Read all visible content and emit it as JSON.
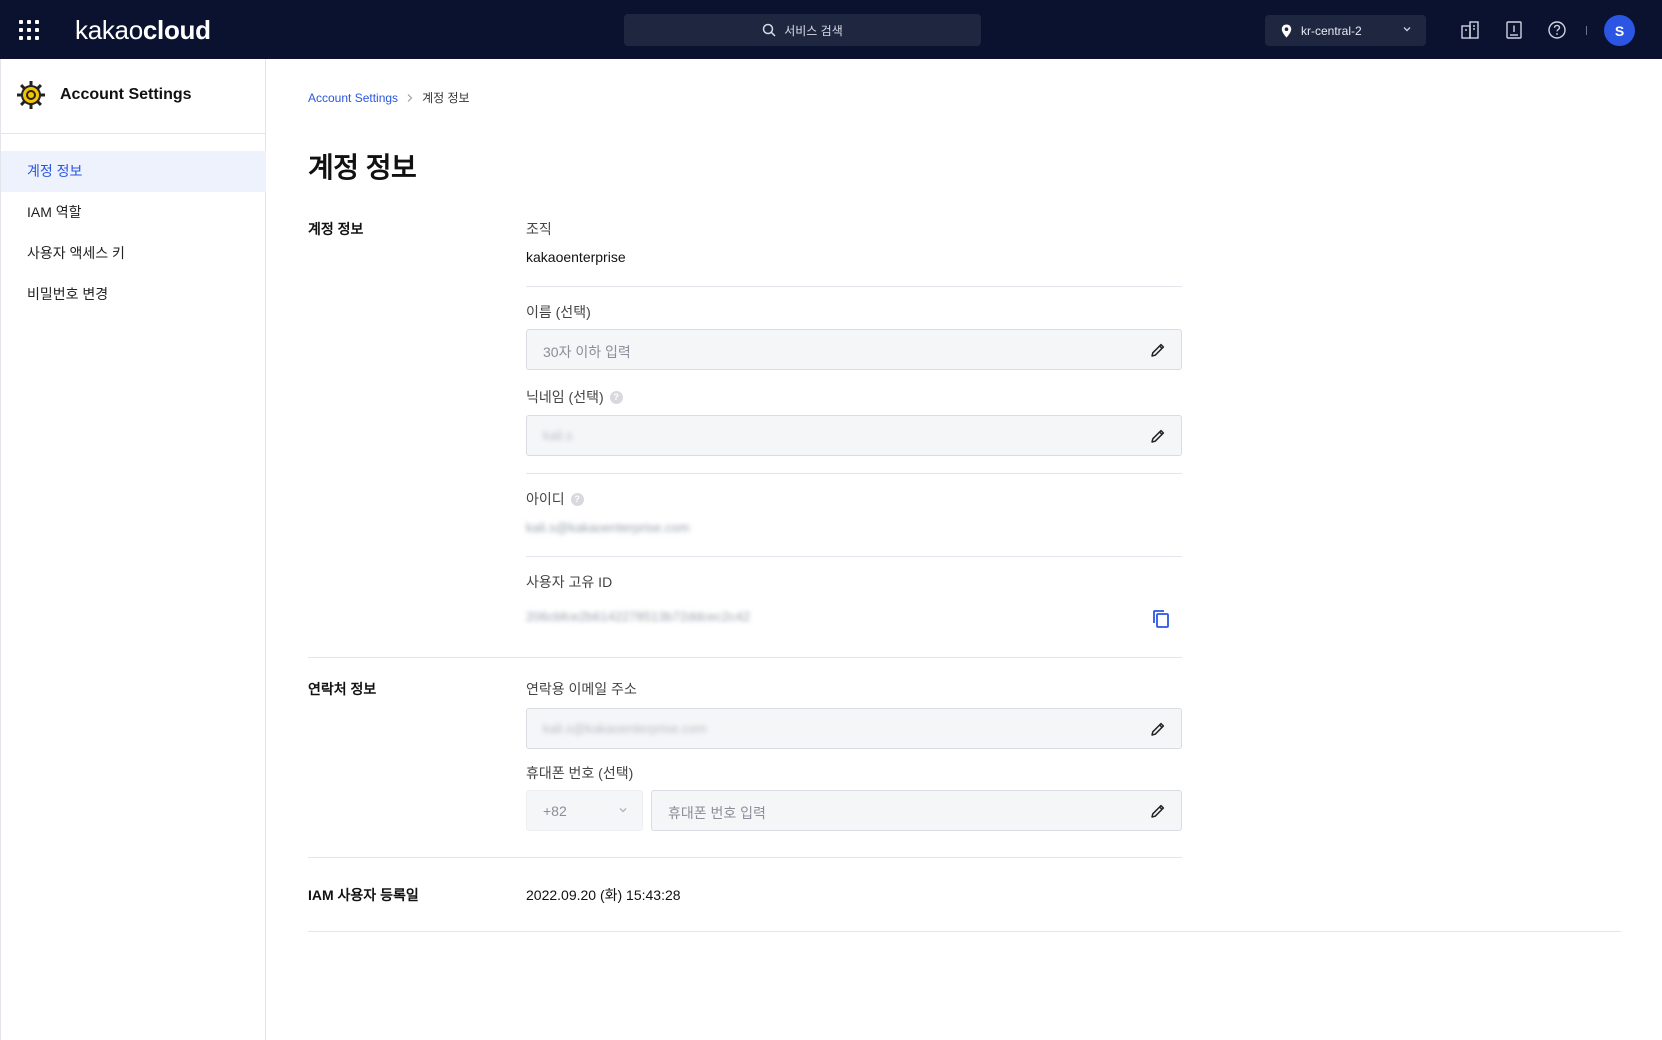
{
  "topbar": {
    "logo_light": "kakao",
    "logo_bold": "cloud",
    "search_placeholder": "서비스 검색",
    "region": "kr-central-2",
    "avatar_initial": "S"
  },
  "sidebar": {
    "title": "Account Settings",
    "items": [
      {
        "label": "계정 정보",
        "active": true
      },
      {
        "label": "IAM 역할",
        "active": false
      },
      {
        "label": "사용자 액세스 키",
        "active": false
      },
      {
        "label": "비밀번호 변경",
        "active": false
      }
    ]
  },
  "breadcrumb": {
    "root": "Account Settings",
    "current": "계정 정보"
  },
  "page": {
    "title": "계정 정보"
  },
  "account_section": {
    "label": "계정 정보",
    "org_label": "조직",
    "org_value": "kakaoenterprise",
    "name_label": "이름 (선택)",
    "name_placeholder": "30자 이하 입력",
    "nickname_label": "닉네임 (선택)",
    "nickname_value": "kali.s",
    "id_label": "아이디",
    "id_value": "kali.s@kakaoenterprise.com",
    "uid_label": "사용자 고유 ID",
    "uid_value": "206cbfce2b6142278513b72ddcec2c42"
  },
  "contact_section": {
    "label": "연락처 정보",
    "email_label": "연락용 이메일 주소",
    "email_value": "kali.s@kakaoenterprise.com",
    "phone_label": "휴대폰 번호 (선택)",
    "country_code": "+82",
    "phone_placeholder": "휴대폰 번호 입력"
  },
  "registration": {
    "label": "IAM 사용자 등록일",
    "value": "2022.09.20 (화) 15:43:28"
  },
  "colors": {
    "topbar_bg": "#0b1230",
    "accent": "#2a56e3",
    "active_bg": "#eef2fd"
  },
  "icons": [
    "apps-grid-icon",
    "search-icon",
    "location-pin-icon",
    "chevron-down-icon",
    "building-icon",
    "document-icon",
    "help-circle-icon",
    "settings-gear-icon",
    "pencil-icon",
    "copy-icon"
  ]
}
